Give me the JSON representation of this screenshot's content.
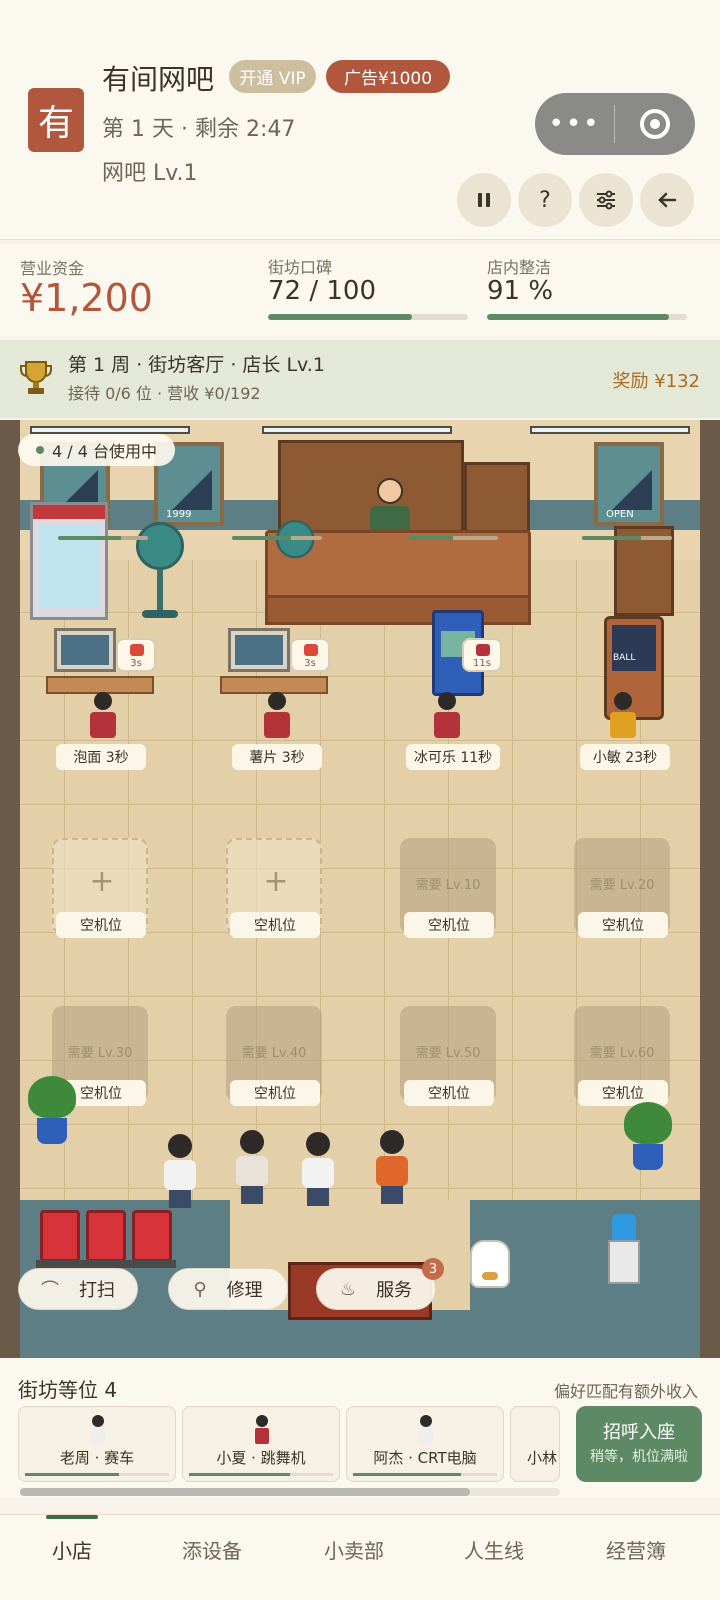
{
  "header": {
    "logo_char": "有",
    "title": "有间网吧",
    "vip_label": "开通 VIP",
    "ad_label": "广告¥1000",
    "day_line": "第 1 天 · 剩余 2:47",
    "level_line": "网吧 Lv.1",
    "help_label": "?"
  },
  "stats": {
    "funds_label": "营业资金",
    "funds_value": "¥1,200",
    "reputation_label": "街坊口碑",
    "reputation_value": "72 / 100",
    "reputation_fraction": 0.72,
    "clean_label": "店内整洁",
    "clean_value": "91 %",
    "clean_fraction": 0.91
  },
  "quest": {
    "title": "第 1 周 · 街坊客厅 · 店长 Lv.1",
    "subtitle": "接待 0/6 位 · 营收 ¥0/192",
    "reward": "奖励 ¥132"
  },
  "game": {
    "usage": "4 / 4 台使用中",
    "poster1_text": "1999",
    "poster2_text": "OPEN",
    "pinball_text": "BALL",
    "stations": [
      {
        "label": "泡面 3秒",
        "timer": "3s",
        "progress": 0.7
      },
      {
        "label": "薯片 3秒",
        "timer": "3s",
        "progress": 0.65
      },
      {
        "label": "冰可乐 11秒",
        "timer": "11s",
        "progress": 0.5
      },
      {
        "label": "小敏 23秒",
        "progress": 0.65
      }
    ],
    "slots_row1": [
      {
        "label": "空机位",
        "lock": ""
      },
      {
        "label": "空机位",
        "lock": ""
      },
      {
        "label": "空机位",
        "lock": "需要 Lv.10"
      },
      {
        "label": "空机位",
        "lock": "需要 Lv.20"
      }
    ],
    "slots_row2": [
      {
        "label": "空机位",
        "lock": "需要 Lv.30"
      },
      {
        "label": "空机位",
        "lock": "需要 Lv.40"
      },
      {
        "label": "空机位",
        "lock": "需要 Lv.50"
      },
      {
        "label": "空机位",
        "lock": "需要 Lv.60"
      }
    ],
    "actions": {
      "sweep": "打扫",
      "repair": "修理",
      "service": "服务",
      "service_badge": "3"
    }
  },
  "queue": {
    "title": "街坊等位 4",
    "hint": "偏好匹配有额外收入",
    "customers": [
      {
        "label": "老周 · 赛车",
        "progress": 0.65
      },
      {
        "label": "小夏 · 跳舞机",
        "progress": 0.7
      },
      {
        "label": "阿杰 · CRT电脑",
        "progress": 0.75
      },
      {
        "label": "小林"
      }
    ],
    "call_main": "招呼入座",
    "call_sub": "稍等，机位满啦"
  },
  "nav": {
    "items": [
      "小店",
      "添设备",
      "小卖部",
      "人生线",
      "经营簿"
    ],
    "active": 0
  },
  "colors": {
    "accent_red": "#b0573e",
    "accent_green": "#5d8a64",
    "background": "#f7f3ea"
  }
}
